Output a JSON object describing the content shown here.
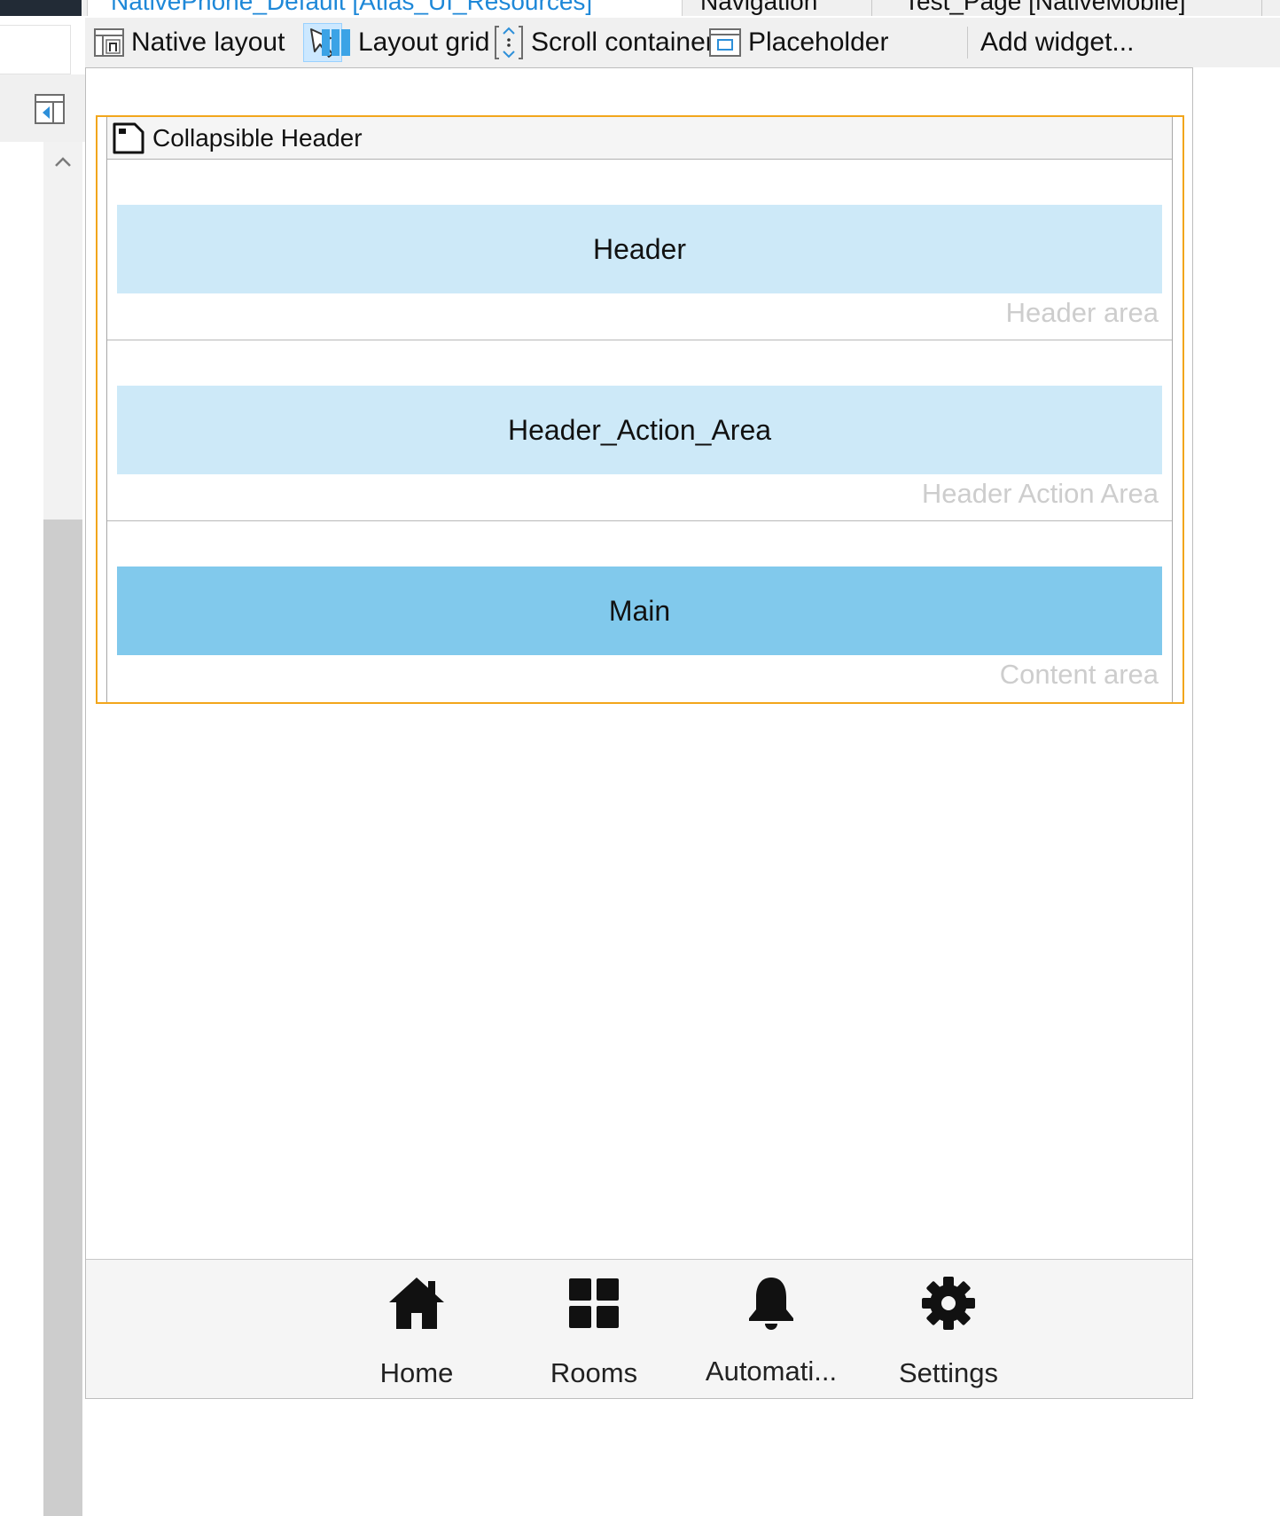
{
  "tabs": [
    {
      "label": "NativePhone_Default [Atlas_UI_Resources]",
      "active": true
    },
    {
      "label": "Navigation",
      "active": false
    },
    {
      "label": "Test_Page [NativeMobile]",
      "active": false
    }
  ],
  "toolbar": {
    "native_layout": "Native layout",
    "layout_grid": "Layout grid",
    "scroll_container": "Scroll container",
    "placeholder": "Placeholder",
    "add_widget": "Add widget..."
  },
  "widget": {
    "title": "Collapsible Header",
    "regions": [
      {
        "placeholder": "Header",
        "label": "Header area"
      },
      {
        "placeholder": "Header_Action_Area",
        "label": "Header Action Area"
      },
      {
        "placeholder": "Main",
        "label": "Content area"
      }
    ]
  },
  "bottom_nav": {
    "items": [
      {
        "label": "Home",
        "icon": "home-icon"
      },
      {
        "label": "Rooms",
        "icon": "grid-icon"
      },
      {
        "label": "Automati...",
        "icon": "bell-icon"
      },
      {
        "label": "Settings",
        "icon": "gear-icon"
      }
    ]
  },
  "colors": {
    "selection_outline": "#f2a61c",
    "placeholder_light": "#cde9f8",
    "placeholder_main": "#81c9ec",
    "active_tab_text": "#1e88d8"
  }
}
